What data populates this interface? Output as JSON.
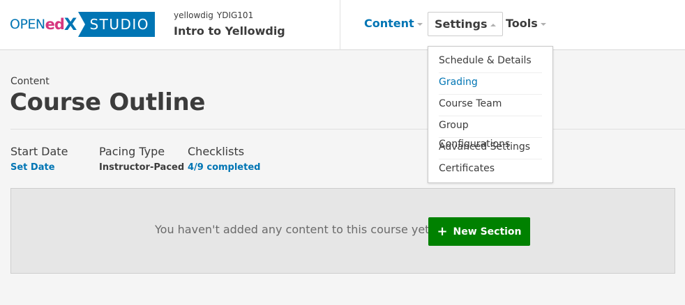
{
  "brand": {
    "logo_open": "OPEN",
    "logo_ed": "ed",
    "logo_x": "X",
    "logo_studio": "STUDIO",
    "colors": {
      "primary": "#0075b4",
      "magenta": "#d6377f",
      "success": "#008100"
    }
  },
  "course": {
    "org": "yellowdig",
    "number": "YDIG101",
    "title": "Intro to Yellowdig"
  },
  "nav": {
    "content_label": "Content",
    "settings_label": "Settings",
    "tools_label": "Tools",
    "settings_menu": [
      {
        "label": "Schedule & Details",
        "active": false
      },
      {
        "label": "Grading",
        "active": true
      },
      {
        "label": "Course Team",
        "active": false
      },
      {
        "label": "Group Configurations",
        "active": false
      },
      {
        "label": "Advanced Settings",
        "active": false
      },
      {
        "label": "Certificates",
        "active": false
      }
    ]
  },
  "page": {
    "subtitle": "Content",
    "title": "Course Outline"
  },
  "status": {
    "start_date_label": "Start Date",
    "start_date_value": "Set Date",
    "pacing_label": "Pacing Type",
    "pacing_value": "Instructor-Paced",
    "checklists_label": "Checklists",
    "checklists_value": "4/9 completed"
  },
  "outline": {
    "empty_message": "You haven't added any content to this course yet.",
    "new_section_icon": "+",
    "new_section_label": "New Section"
  }
}
